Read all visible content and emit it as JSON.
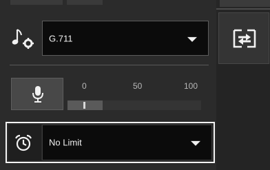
{
  "codec": {
    "icon": "music-note-gear-icon",
    "selected": "G.711"
  },
  "volume": {
    "icon": "microphone-icon",
    "ticks": [
      "0",
      "50",
      "100"
    ],
    "value_percent": 13
  },
  "limit": {
    "icon": "alarm-clock-icon",
    "selected": "No Limit"
  },
  "side": {
    "swap_icon": "swap-icon"
  },
  "colors": {
    "background": "#2b2b2b",
    "select_background": "#0b0b0b",
    "focus_outline": "#f4f4f4"
  }
}
